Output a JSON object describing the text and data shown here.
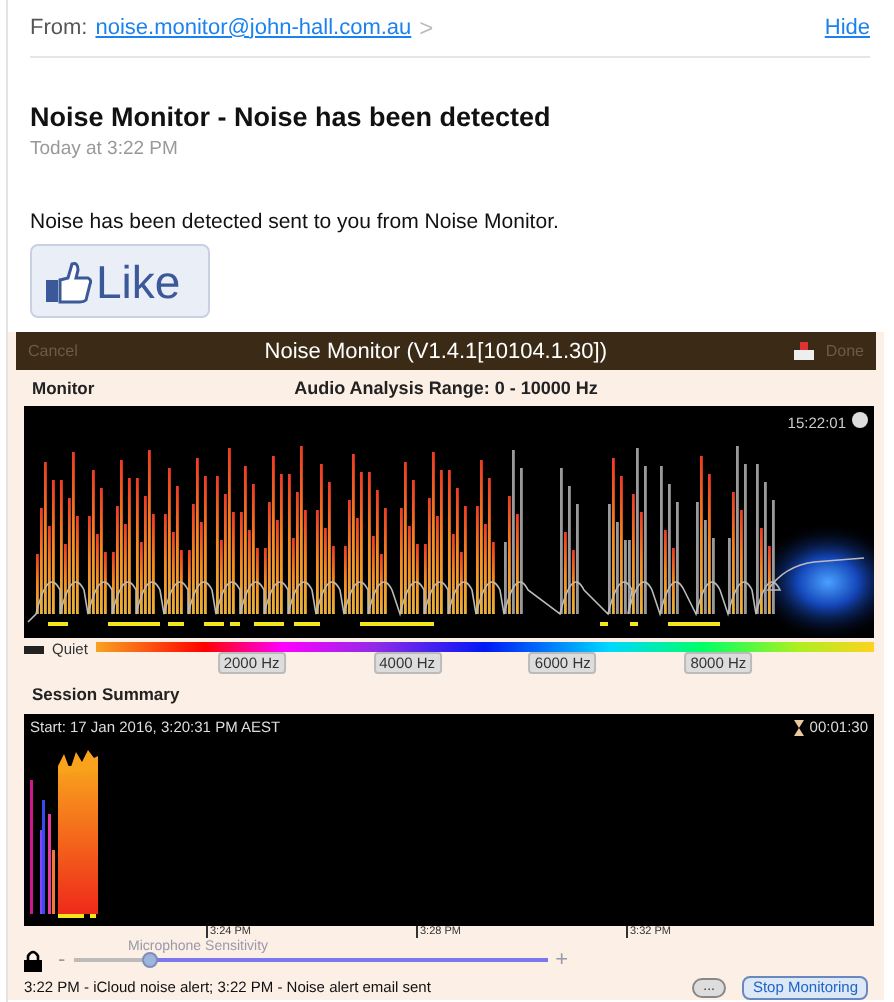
{
  "email": {
    "from_label": "From:",
    "from_address": "noise.monitor@john-hall.com.au",
    "chevron": ">",
    "hide": "Hide",
    "subject": "Noise Monitor - Noise has been detected",
    "date": "Today at 3:22 PM",
    "body": "Noise has been detected sent to you from Noise Monitor.",
    "like_button": "Like"
  },
  "app": {
    "cancel": {
      "label": "Cancel",
      "disabled": true
    },
    "title": "Noise Monitor (V1.4.1[10104.1.30])",
    "done": {
      "label": "Done",
      "disabled": true
    }
  },
  "monitor": {
    "label": "Monitor",
    "range": "Audio Analysis Range: 0 - 10000 Hz",
    "time": "15:22:01",
    "legend_quiet": "Quiet",
    "freq_labels": [
      "2000 Hz",
      "4000 Hz",
      "6000 Hz",
      "8000 Hz"
    ]
  },
  "session": {
    "label": "Session Summary",
    "start": "Start: 17 Jan 2016, 3:20:31 PM AEST",
    "elapsed": "00:01:30",
    "time_ticks": [
      "3:24 PM",
      "3:28 PM",
      "3:32 PM"
    ]
  },
  "sensitivity": {
    "minus": "-",
    "plus": "+",
    "label": "Microphone  Sensitivity",
    "level": 0.16
  },
  "status": "3:22 PM - iCloud noise alert; 3:22 PM - Noise alert email sent",
  "buttons": [
    {
      "kind": "more",
      "label": "..."
    },
    {
      "kind": "stop",
      "label": "Stop Monitoring"
    }
  ]
}
